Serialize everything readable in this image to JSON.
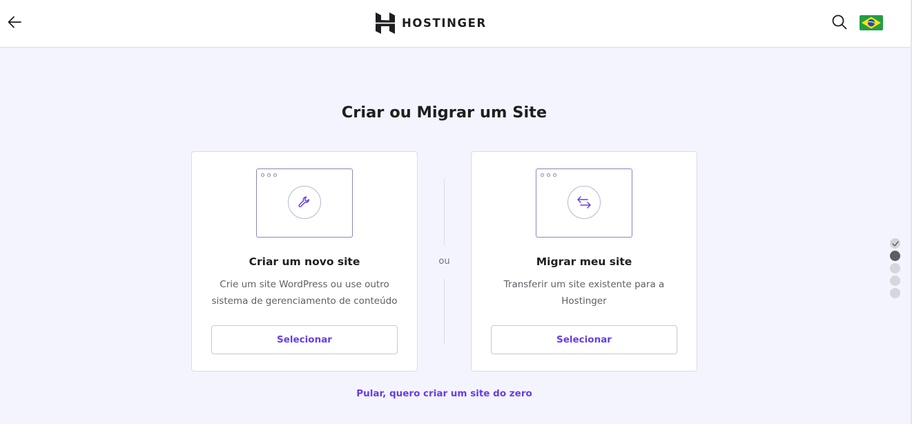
{
  "header": {
    "logo_text": "HOSTINGER",
    "back_icon": "arrow-left-icon",
    "search_icon": "search-icon",
    "language_flag": "brazil-flag-icon"
  },
  "page": {
    "title": "Criar ou Migrar um Site",
    "divider_text": "ou",
    "skip_link": "Pular, quero criar um site do zero"
  },
  "cards": [
    {
      "title": "Criar um novo site",
      "description": "Crie um site WordPress ou use outro sistema de gerenciamento de conteúdo",
      "button_label": "Selecionar",
      "icon": "wrench-icon"
    },
    {
      "title": "Migrar meu site",
      "description": "Transferir um site existente para a Hostinger",
      "button_label": "Selecionar",
      "icon": "transfer-arrows-icon"
    }
  ],
  "progress": {
    "total_steps": 5,
    "completed_steps": 1,
    "current_step": 2
  },
  "colors": {
    "accent": "#673de6",
    "background": "#f4f4fe",
    "text": "#1d1e20"
  }
}
